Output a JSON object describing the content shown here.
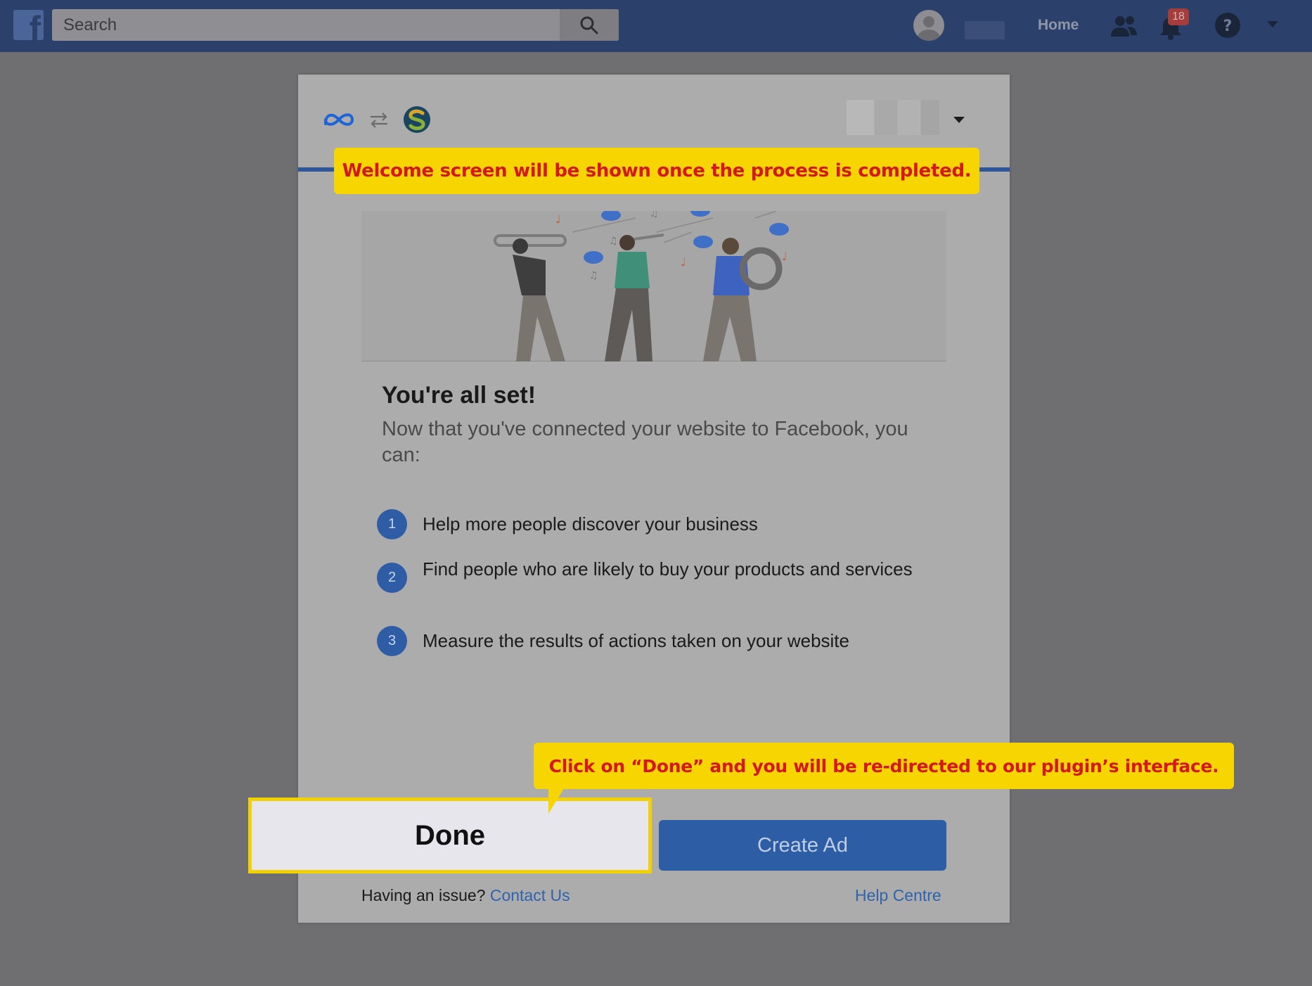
{
  "topbar": {
    "search_placeholder": "Search",
    "nav_home": "Home",
    "notification_count": "18",
    "icons": [
      "facebook-logo",
      "search-icon",
      "friends-icon",
      "bell-icon",
      "help-icon",
      "caret-down-icon"
    ]
  },
  "modal": {
    "title": "You're all set!",
    "subtitle": "Now that you've connected your website to Facebook, you can:",
    "steps": [
      {
        "num": "1",
        "text": "Help more people discover your business"
      },
      {
        "num": "2",
        "text": "Find people who are likely to buy your products and services"
      },
      {
        "num": "3",
        "text": "Measure the results of actions taken on your website"
      }
    ],
    "done_label": "Done",
    "create_ad_label": "Create Ad",
    "issue_text": "Having an issue?",
    "contact_label": "Contact Us",
    "help_label": "Help Centre"
  },
  "callouts": {
    "welcome": "Welcome screen will be shown once the process is completed.",
    "done_hint": "Click on “Done” and you will be re-directed to our plugin’s interface."
  },
  "colors": {
    "topbar": "#2b416b",
    "accent_blue": "#2d5ea5",
    "callout_bg": "#f6d500",
    "callout_text": "#d5171e"
  }
}
